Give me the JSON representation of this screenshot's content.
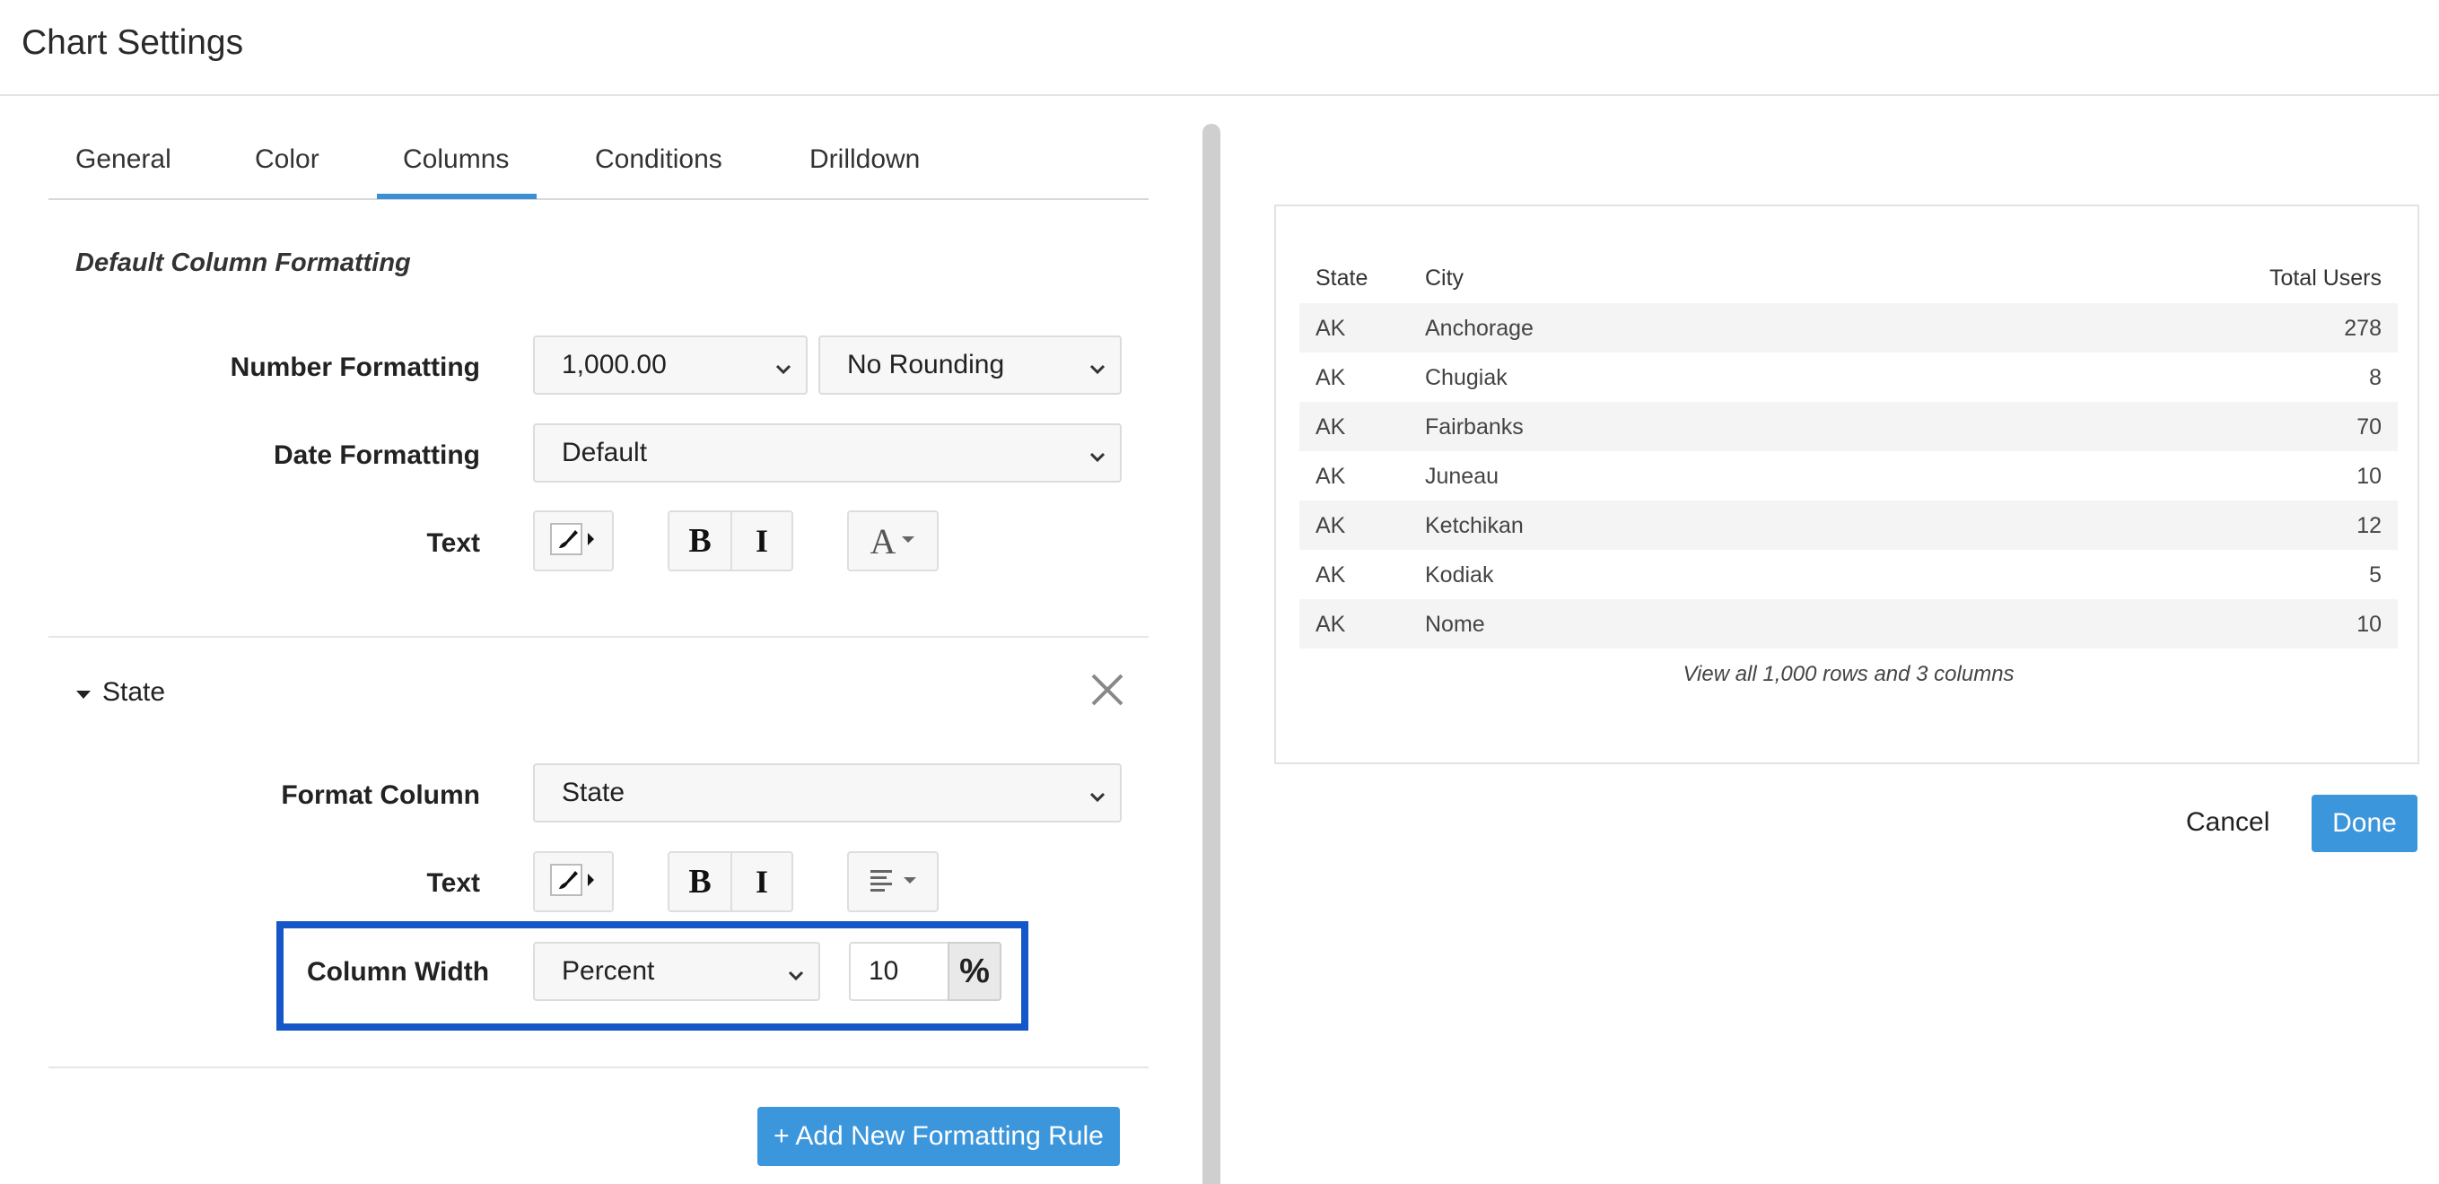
{
  "header": {
    "title": "Chart Settings"
  },
  "tabs": [
    {
      "label": "General"
    },
    {
      "label": "Color"
    },
    {
      "label": "Columns"
    },
    {
      "label": "Conditions"
    },
    {
      "label": "Drilldown"
    }
  ],
  "active_tab": "Columns",
  "default_formatting": {
    "title": "Default Column Formatting",
    "number_label": "Number Formatting",
    "number_format_value": "1,000.00",
    "rounding_value": "No Rounding",
    "date_label": "Date Formatting",
    "date_value": "Default",
    "text_label": "Text",
    "bold": "B",
    "italic": "I",
    "font_glyph": "A"
  },
  "column_rule": {
    "title": "State",
    "format_column_label": "Format Column",
    "format_column_value": "State",
    "text_label": "Text",
    "bold": "B",
    "italic": "I",
    "width_label": "Column Width",
    "width_mode_value": "Percent",
    "width_value": "10",
    "width_unit": "%"
  },
  "add_rule_label": "+ Add New Formatting Rule",
  "preview": {
    "columns": [
      "State",
      "City",
      "Total Users"
    ],
    "rows": [
      [
        "AK",
        "Anchorage",
        "278"
      ],
      [
        "AK",
        "Chugiak",
        "8"
      ],
      [
        "AK",
        "Fairbanks",
        "70"
      ],
      [
        "AK",
        "Juneau",
        "10"
      ],
      [
        "AK",
        "Ketchikan",
        "12"
      ],
      [
        "AK",
        "Kodiak",
        "5"
      ],
      [
        "AK",
        "Nome",
        "10"
      ]
    ],
    "footer": "View all 1,000 rows and 3 columns"
  },
  "actions": {
    "cancel": "Cancel",
    "done": "Done"
  },
  "colors": {
    "accent": "#3c96dc",
    "highlight": "#1556c9"
  }
}
